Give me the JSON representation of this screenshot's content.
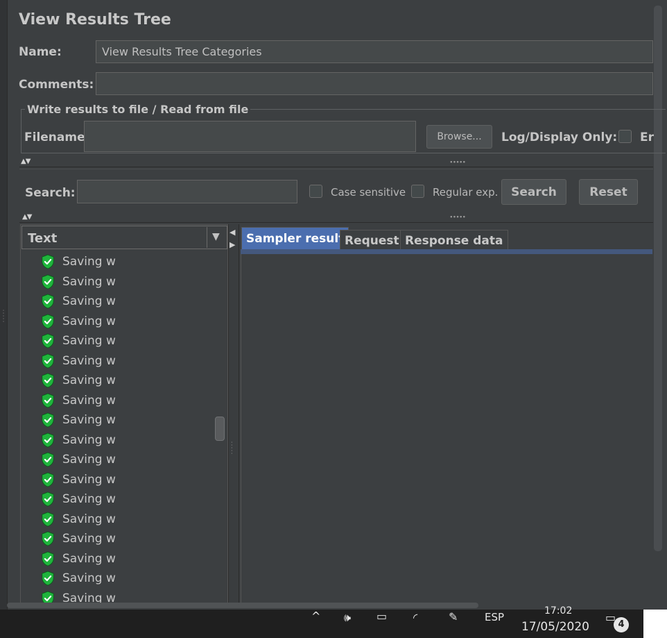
{
  "panel_title": "View Results Tree",
  "name": {
    "label": "Name:",
    "value": "View Results Tree Categories"
  },
  "comments": {
    "label": "Comments:",
    "value": ""
  },
  "file_section": {
    "legend": "Write results to file / Read from file",
    "filename_label": "Filename",
    "filename_value": "",
    "browse_label": "Browse...",
    "log_display_label": "Log/Display Only:",
    "errors_label": "Er"
  },
  "search": {
    "label": "Search:",
    "value": "",
    "case_sensitive_label": "Case sensitive",
    "regular_exp_label": "Regular exp.",
    "search_button": "Search",
    "reset_button": "Reset"
  },
  "tree": {
    "renderer": "Text",
    "items": [
      {
        "label": "Saving w",
        "status": "success"
      },
      {
        "label": "Saving w",
        "status": "success"
      },
      {
        "label": "Saving w",
        "status": "success"
      },
      {
        "label": "Saving w",
        "status": "success"
      },
      {
        "label": "Saving w",
        "status": "success"
      },
      {
        "label": "Saving w",
        "status": "success"
      },
      {
        "label": "Saving w",
        "status": "success"
      },
      {
        "label": "Saving w",
        "status": "success"
      },
      {
        "label": "Saving w",
        "status": "success"
      },
      {
        "label": "Saving w",
        "status": "success"
      },
      {
        "label": "Saving w",
        "status": "success"
      },
      {
        "label": "Saving w",
        "status": "success"
      },
      {
        "label": "Saving w",
        "status": "success"
      },
      {
        "label": "Saving w",
        "status": "success"
      },
      {
        "label": "Saving w",
        "status": "success"
      },
      {
        "label": "Saving w",
        "status": "success"
      },
      {
        "label": "Saving w",
        "status": "success"
      },
      {
        "label": "Saving w",
        "status": "success"
      }
    ]
  },
  "tabs": [
    {
      "label": "Sampler result",
      "active": true
    },
    {
      "label": "Request",
      "active": false
    },
    {
      "label": "Response data",
      "active": false
    }
  ],
  "taskbar": {
    "language": "ESP",
    "time": "17:02",
    "date": "17/05/2020",
    "notification_count": "4"
  },
  "colors": {
    "background": "#3c3f41",
    "accent": "#4b6eaf",
    "success_icon": "#1fb43c"
  }
}
